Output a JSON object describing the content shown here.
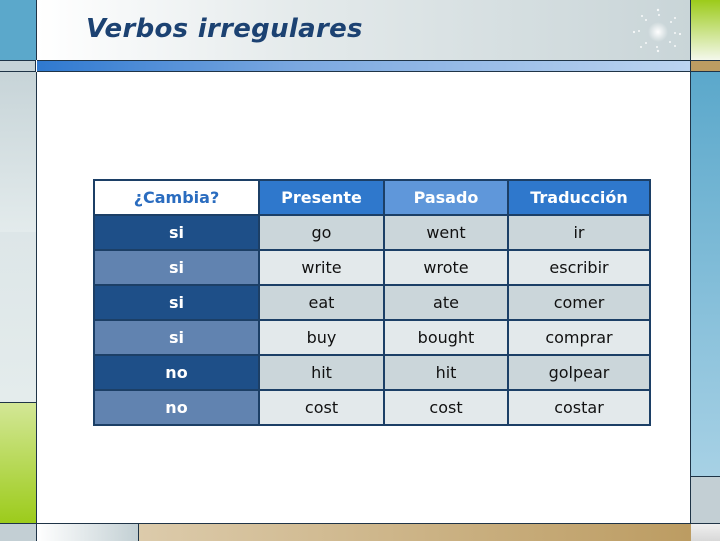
{
  "slide": {
    "title": "Verbos irregulares",
    "decor_icon": "sparkle-icon"
  },
  "table": {
    "headers": [
      "¿Cambia?",
      "Presente",
      "Pasado",
      "Traducción"
    ],
    "rows": [
      [
        "si",
        "go",
        "went",
        "ir"
      ],
      [
        "si",
        "write",
        "wrote",
        "escribir"
      ],
      [
        "si",
        "eat",
        "ate",
        "comer"
      ],
      [
        "si",
        "buy",
        "bought",
        "comprar"
      ],
      [
        "no",
        "hit",
        "hit",
        "golpear"
      ],
      [
        "no",
        "cost",
        "cost",
        "costar"
      ]
    ]
  },
  "colors": {
    "title": "#1c4272",
    "header_blue": "#2f78cc",
    "header_blue_alt": "#5f97da",
    "row_dark_label": "#1e4f88",
    "row_light_label": "#6183b0",
    "accent_green": "#9ccb1a",
    "accent_tan": "#bc9c62"
  }
}
